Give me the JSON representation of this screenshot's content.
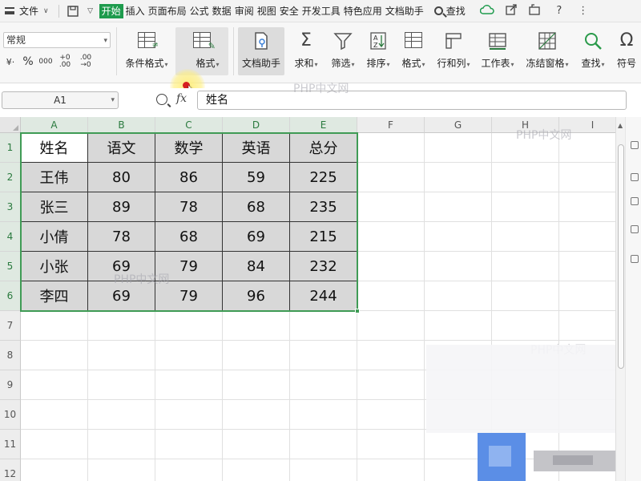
{
  "menubar": {
    "file_label": "文件",
    "tabs": [
      {
        "label": "开始",
        "active": true
      },
      {
        "label": "插入"
      },
      {
        "label": "页面布局"
      },
      {
        "label": "公式"
      },
      {
        "label": "数据"
      },
      {
        "label": "审阅"
      },
      {
        "label": "视图"
      },
      {
        "label": "安全"
      },
      {
        "label": "开发工具"
      },
      {
        "label": "特色应用"
      },
      {
        "label": "文档助手"
      }
    ],
    "search_label": "查找",
    "help_glyph": "?",
    "more_glyph": "⋮",
    "accent_color": "#1e9b4d"
  },
  "ribbon": {
    "number_format": "常规",
    "num_buttons": [
      {
        "name": "currency",
        "label": "¥·"
      },
      {
        "name": "percent",
        "label": "%"
      },
      {
        "name": "thousands",
        "label": "000"
      },
      {
        "name": "increase-decimal",
        "label": "+0 .00"
      },
      {
        "name": "decrease-decimal",
        "label": ".00 →0"
      }
    ],
    "buttons": [
      {
        "name": "conditional-format",
        "label": "条件格式"
      },
      {
        "name": "table-style",
        "label": "格式"
      },
      {
        "name": "doc-assistant",
        "label": "文档助手"
      },
      {
        "name": "sum",
        "label": "求和"
      },
      {
        "name": "filter",
        "label": "筛选"
      },
      {
        "name": "sort",
        "label": "排序"
      },
      {
        "name": "format",
        "label": "格式"
      },
      {
        "name": "rows-columns",
        "label": "行和列"
      },
      {
        "name": "worksheet",
        "label": "工作表"
      },
      {
        "name": "freeze-panes",
        "label": "冻结窗格"
      },
      {
        "name": "find",
        "label": "查找"
      },
      {
        "name": "symbol",
        "label": "符号"
      }
    ]
  },
  "formula_bar": {
    "cell_ref": "A1",
    "fx_label": "fx",
    "content": "姓名"
  },
  "sheet": {
    "columns": [
      "A",
      "B",
      "C",
      "D",
      "E",
      "F",
      "G",
      "H",
      "I"
    ],
    "rows": [
      "1",
      "2",
      "3",
      "4",
      "5",
      "6",
      "7",
      "8",
      "9",
      "10",
      "11",
      "12"
    ],
    "table": [
      [
        "姓名",
        "语文",
        "数学",
        "英语",
        "总分"
      ],
      [
        "王伟",
        "80",
        "86",
        "59",
        "225"
      ],
      [
        "张三",
        "89",
        "78",
        "68",
        "235"
      ],
      [
        "小倩",
        "78",
        "68",
        "69",
        "215"
      ],
      [
        "小张",
        "69",
        "79",
        "84",
        "232"
      ],
      [
        "李四",
        "69",
        "79",
        "96",
        "244"
      ]
    ],
    "selection_color": "#3f9b55"
  },
  "watermarks": [
    "PHP中文网",
    "PHP中文网",
    "PHP中文网",
    "PHP中文网"
  ]
}
